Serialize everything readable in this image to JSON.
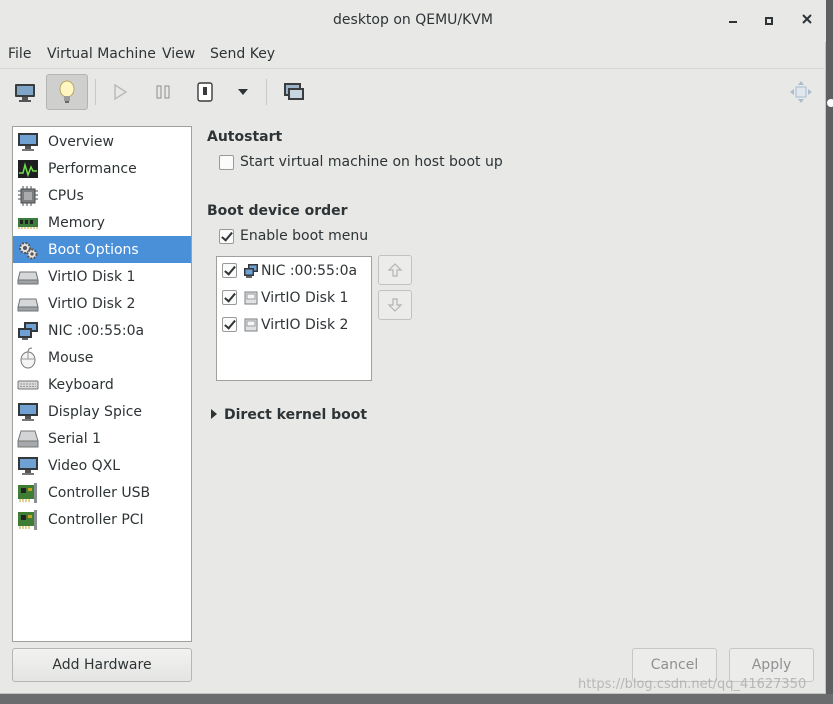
{
  "window": {
    "title": "desktop on QEMU/KVM"
  },
  "menubar": {
    "items": [
      "File",
      "Virtual Machine",
      "View",
      "Send Key"
    ]
  },
  "toolbar": {
    "icons": [
      "monitor-icon",
      "lightbulb-icon",
      "play-icon",
      "pause-icon",
      "power-icon",
      "dropdown-arrow-icon",
      "screenshot-icon",
      "fullscreen-icon"
    ]
  },
  "sidebar": {
    "items": [
      {
        "label": "Overview",
        "icon": "overview-icon"
      },
      {
        "label": "Performance",
        "icon": "performance-icon"
      },
      {
        "label": "CPUs",
        "icon": "cpu-icon"
      },
      {
        "label": "Memory",
        "icon": "memory-icon"
      },
      {
        "label": "Boot Options",
        "icon": "boot-options-icon",
        "selected": true
      },
      {
        "label": "VirtIO Disk 1",
        "icon": "disk-icon"
      },
      {
        "label": "VirtIO Disk 2",
        "icon": "disk-icon"
      },
      {
        "label": "NIC :00:55:0a",
        "icon": "network-icon"
      },
      {
        "label": "Mouse",
        "icon": "mouse-icon"
      },
      {
        "label": "Keyboard",
        "icon": "keyboard-icon"
      },
      {
        "label": "Display Spice",
        "icon": "display-icon"
      },
      {
        "label": "Serial 1",
        "icon": "serial-icon"
      },
      {
        "label": "Video QXL",
        "icon": "video-icon"
      },
      {
        "label": "Controller USB",
        "icon": "controller-icon"
      },
      {
        "label": "Controller PCI",
        "icon": "controller-icon"
      }
    ],
    "add_hardware_label": "Add Hardware"
  },
  "autostart": {
    "title": "Autostart",
    "checkbox_label": "Start virtual machine on host boot up",
    "checked": false
  },
  "boot_order": {
    "title": "Boot device order",
    "enable_menu_label": "Enable boot menu",
    "enable_menu_checked": true,
    "devices": [
      {
        "label": "NIC :00:55:0a",
        "checked": true,
        "icon": "network-icon"
      },
      {
        "label": "VirtIO Disk 1",
        "checked": true,
        "icon": "disk-icon"
      },
      {
        "label": "VirtIO Disk 2",
        "checked": true,
        "icon": "disk-icon"
      }
    ]
  },
  "kernel_boot": {
    "label": "Direct kernel boot"
  },
  "footer": {
    "cancel_label": "Cancel",
    "apply_label": "Apply"
  },
  "watermark": {
    "text": "https://blog.csdn.net/qq_41627350"
  },
  "colors": {
    "selection": "#4a90d9",
    "window_bg": "#e8e8e7"
  }
}
